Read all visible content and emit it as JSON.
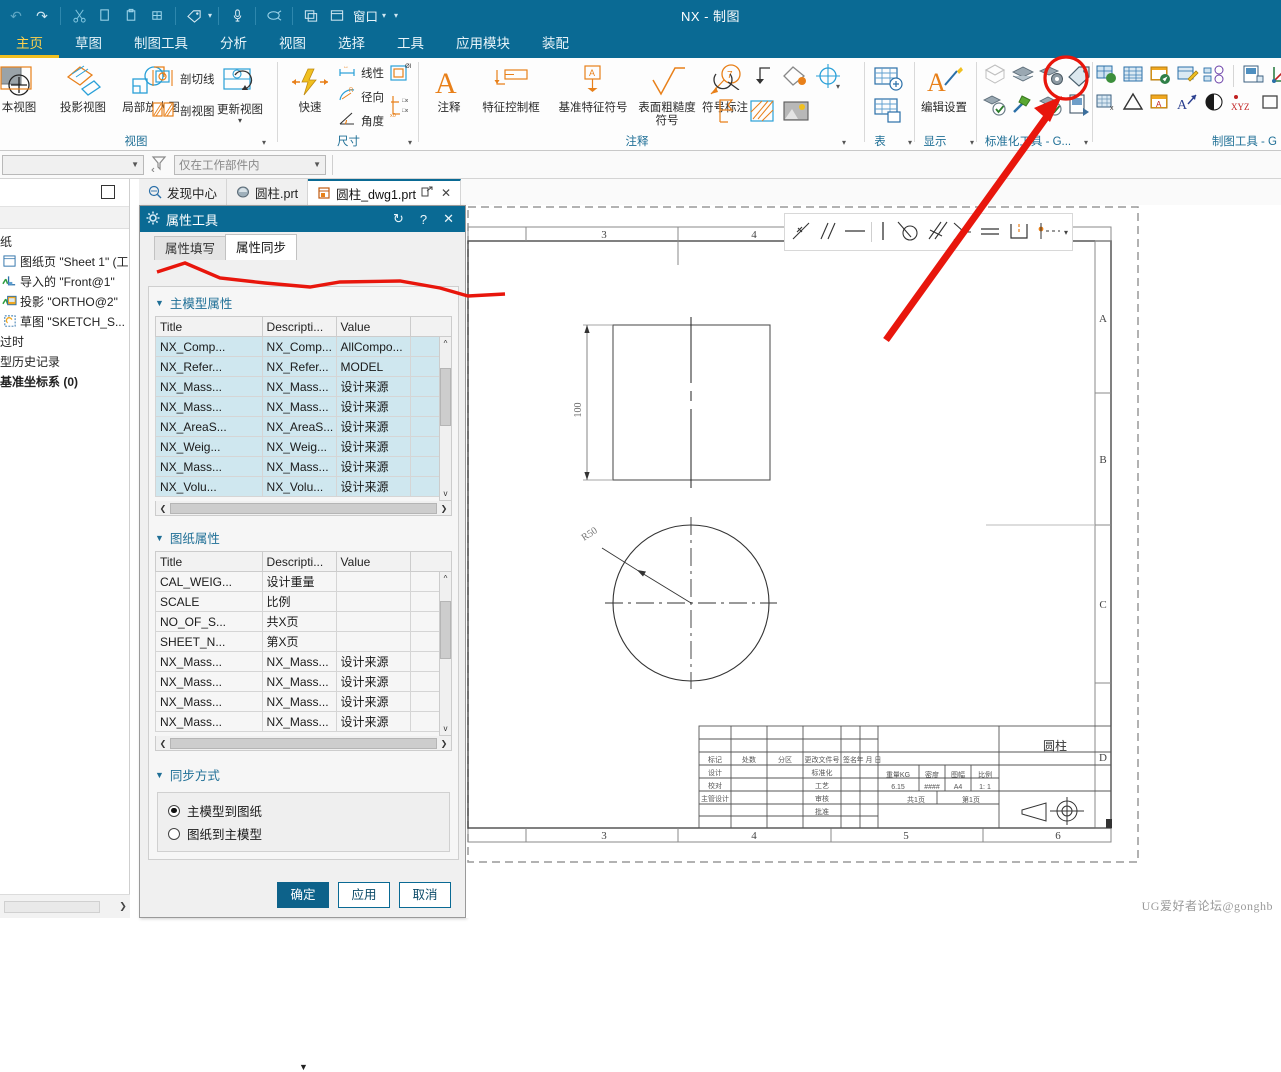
{
  "titlebar": {
    "app_title": "NX - 制图",
    "quick_access": [
      {
        "name": "undo-icon",
        "glyph": "↶"
      },
      {
        "name": "redo-icon",
        "glyph": "↷"
      },
      {
        "name": "cut-icon",
        "glyph": "✂"
      },
      {
        "name": "copy-icon",
        "glyph": "❐"
      },
      {
        "name": "paste-icon",
        "glyph": "📋"
      },
      {
        "name": "paste-special-icon",
        "glyph": "⎘"
      },
      {
        "name": "tag-icon",
        "glyph": "🏷"
      },
      {
        "name": "microphone-icon",
        "glyph": "🎙"
      },
      {
        "name": "command-finder-icon",
        "glyph": "🔊"
      },
      {
        "name": "cascade-windows-icon",
        "glyph": "❏"
      },
      {
        "name": "window-icon",
        "glyph": "▭"
      }
    ],
    "window_label": "窗口"
  },
  "menu": {
    "items": [
      {
        "label": "主页",
        "active": true
      },
      {
        "label": "草图",
        "active": false
      },
      {
        "label": "制图工具",
        "active": false
      },
      {
        "label": "分析",
        "active": false
      },
      {
        "label": "视图",
        "active": false
      },
      {
        "label": "选择",
        "active": false
      },
      {
        "label": "工具",
        "active": false
      },
      {
        "label": "应用模块",
        "active": false
      },
      {
        "label": "装配",
        "active": false
      }
    ]
  },
  "ribbon": {
    "groups": [
      {
        "name": "视图",
        "title": "视图",
        "big_buttons": [
          {
            "label": "本视图",
            "icon": "base-view-icon"
          },
          {
            "label": "投影视图",
            "icon": "projected-view-icon"
          },
          {
            "label": "局部放大图",
            "icon": "detail-view-icon"
          }
        ],
        "small_buttons": [
          {
            "label": "剖切线",
            "icon": "section-line-icon"
          },
          {
            "label": "剖视图",
            "icon": "section-view-icon"
          },
          {
            "label": "更新视图",
            "icon": "update-view-icon"
          }
        ]
      },
      {
        "name": "尺寸",
        "title": "尺寸",
        "big_buttons": [
          {
            "label": "快速",
            "icon": "quick-dimension-icon"
          }
        ],
        "small_buttons": [
          {
            "label": "线性",
            "icon": "linear-dimension-icon"
          },
          {
            "label": "径向",
            "icon": "radial-dimension-icon"
          },
          {
            "label": "角度",
            "icon": "angular-dimension-icon"
          },
          {
            "label": "",
            "icon": "diameter-dimension-icon"
          },
          {
            "label": "",
            "icon": "ordinate-dimension-icon"
          }
        ]
      },
      {
        "name": "注释",
        "title": "注释",
        "big_buttons": [
          {
            "label": "注释",
            "icon": "annotation-icon"
          },
          {
            "label": "特征控制框",
            "icon": "feature-control-frame-icon"
          },
          {
            "label": "基准特征符号",
            "icon": "datum-feature-symbol-icon"
          },
          {
            "label": "表面粗糙度符号",
            "icon": "surface-finish-icon"
          },
          {
            "label": "符号标注",
            "icon": "balloon-icon"
          }
        ],
        "small_buttons": [
          {
            "label": "",
            "icon": "centerline-icon"
          },
          {
            "label": "",
            "icon": "leader-icon"
          },
          {
            "label": "",
            "icon": "weld-symbol-icon"
          },
          {
            "label": "",
            "icon": "target-point-icon"
          },
          {
            "label": "",
            "icon": "flag-note-icon"
          },
          {
            "label": "",
            "icon": "hatch-icon"
          },
          {
            "label": "",
            "icon": "image-icon"
          }
        ]
      },
      {
        "name": "表",
        "title": "表",
        "small_buttons": [
          {
            "label": "",
            "icon": "table-add-icon"
          },
          {
            "label": "",
            "icon": "parts-list-icon"
          }
        ]
      },
      {
        "name": "显示",
        "title": "显示",
        "big_buttons": [
          {
            "label": "编辑设置",
            "icon": "edit-settings-icon"
          }
        ]
      },
      {
        "name": "标准化工具",
        "title": "标准化工具 - G...",
        "small_buttons": [
          {
            "label": "",
            "icon": "check-drawing-icon"
          },
          {
            "label": "",
            "icon": "layers-icon"
          },
          {
            "label": "",
            "icon": "layer-settings-icon"
          },
          {
            "label": "",
            "icon": "attribute-tool-icon"
          },
          {
            "label": "",
            "icon": "validate-icon"
          },
          {
            "label": "",
            "icon": "hammer-icon"
          },
          {
            "label": "",
            "icon": "check-box-icon"
          },
          {
            "label": "",
            "icon": "export-sheet-icon"
          }
        ]
      },
      {
        "name": "制图工具",
        "title": "制图工具 - G",
        "small_buttons": [
          {
            "label": "",
            "icon": "insert-table-icon"
          },
          {
            "label": "",
            "icon": "part-family-icon"
          },
          {
            "label": "",
            "icon": "sheet-navigate-icon"
          },
          {
            "label": "",
            "icon": "edit-sheet-icon"
          },
          {
            "label": "",
            "icon": "numbering-icon"
          },
          {
            "label": "",
            "icon": "batch-plot-icon"
          },
          {
            "label": "",
            "icon": "csys-icon"
          },
          {
            "label": "",
            "icon": "frame-icon"
          },
          {
            "label": "",
            "icon": "grid-x-icon"
          },
          {
            "label": "",
            "icon": "triangle-icon"
          },
          {
            "label": "",
            "icon": "table-a-icon"
          },
          {
            "label": "",
            "icon": "text-arrow-icon"
          },
          {
            "label": "",
            "icon": "sphere-icon"
          },
          {
            "label": "",
            "icon": "xyz-icon"
          },
          {
            "label": "",
            "icon": "square-icon"
          },
          {
            "label": "",
            "icon": "link-table-icon"
          },
          {
            "label": "",
            "icon": "list-icon"
          }
        ]
      }
    ],
    "drawing_tools_label": "制图工具 - G"
  },
  "selection_bar": {
    "type_filter_value": "",
    "filter_icon": "filter-icon",
    "scope_value": "仅在工作部件内"
  },
  "left_panel": {
    "tree": [
      {
        "label": "纸",
        "icon": "drawing-icon",
        "indent": 0
      },
      {
        "label": "图纸页 \"Sheet 1\" (工...",
        "icon": "sheet-icon",
        "indent": 0
      },
      {
        "label": "导入的 \"Front@1\"",
        "icon": "imported-view-icon",
        "indent": 1
      },
      {
        "label": "投影 \"ORTHO@2\"",
        "icon": "projected-view-icon",
        "indent": 1
      },
      {
        "label": "草图 \"SKETCH_S...",
        "icon": "sketch-icon",
        "indent": 1
      },
      {
        "label": "过时",
        "icon": "outdated-icon",
        "indent": 0
      },
      {
        "label": "型历史记录",
        "icon": "history-icon",
        "indent": 0
      },
      {
        "label": "基准坐标系 (0)",
        "icon": "datum-csys-icon",
        "indent": 0
      }
    ]
  },
  "file_tabs": [
    {
      "label": "发现中心",
      "icon": "discovery-center-icon",
      "active": false,
      "closable": false
    },
    {
      "label": "圆柱.prt",
      "icon": "part-icon",
      "active": false,
      "closable": false
    },
    {
      "label": "圆柱_dwg1.prt",
      "icon": "drafting-icon",
      "active": true,
      "closable": true,
      "extra_icon": "detach-icon"
    }
  ],
  "dialog": {
    "title": "属性工具",
    "title_icons": [
      {
        "name": "gear-icon",
        "glyph": "⚙"
      },
      {
        "name": "reset-icon",
        "glyph": "↻"
      },
      {
        "name": "help-icon",
        "glyph": "?"
      },
      {
        "name": "close-icon",
        "glyph": "✕"
      }
    ],
    "tabs": [
      {
        "label": "属性填写",
        "selected": false
      },
      {
        "label": "属性同步",
        "selected": true
      }
    ],
    "section_master": {
      "title": "主模型属性",
      "columns": [
        "Title",
        "Descripti...",
        "Value",
        ""
      ],
      "rows": [
        [
          "NX_Comp...",
          "NX_Comp...",
          "AllCompo...",
          ""
        ],
        [
          "NX_Refer...",
          "NX_Refer...",
          "MODEL",
          ""
        ],
        [
          "NX_Mass...",
          "NX_Mass...",
          "设计来源",
          ""
        ],
        [
          "NX_Mass...",
          "NX_Mass...",
          "设计来源",
          ""
        ],
        [
          "NX_AreaS...",
          "NX_AreaS...",
          "设计来源",
          ""
        ],
        [
          "NX_Weig...",
          "NX_Weig...",
          "设计来源",
          ""
        ],
        [
          "NX_Mass...",
          "NX_Mass...",
          "设计来源",
          ""
        ],
        [
          "NX_Volu...",
          "NX_Volu...",
          "设计来源",
          ""
        ]
      ]
    },
    "section_sheet": {
      "title": "图纸属性",
      "columns": [
        "Title",
        "Descripti...",
        "Value",
        ""
      ],
      "rows": [
        [
          "CAL_WEIG...",
          "设计重量",
          "",
          ""
        ],
        [
          "SCALE",
          "比例",
          "",
          ""
        ],
        [
          "NO_OF_S...",
          "共X页",
          "",
          ""
        ],
        [
          "SHEET_N...",
          "第X页",
          "",
          ""
        ],
        [
          "NX_Mass...",
          "NX_Mass...",
          "设计来源",
          ""
        ],
        [
          "NX_Mass...",
          "NX_Mass...",
          "设计来源",
          ""
        ],
        [
          "NX_Mass...",
          "NX_Mass...",
          "设计来源",
          ""
        ],
        [
          "NX_Mass...",
          "NX_Mass...",
          "设计来源",
          ""
        ]
      ]
    },
    "section_sync": {
      "title": "同步方式",
      "options": [
        {
          "label": "主模型到图纸",
          "selected": true
        },
        {
          "label": "图纸到主模型",
          "selected": false
        }
      ]
    },
    "footer": {
      "ok": "确定",
      "apply": "应用",
      "cancel": "取消"
    }
  },
  "canvas": {
    "float_toolbar_icons": [
      "coincident-constraint-icon",
      "parallel-constraint-icon",
      "horizontal-constraint-icon",
      "vertical-constraint-icon",
      "tangent-constraint-icon",
      "perpendicular-constraint-icon",
      "angle-constraint-icon",
      "equal-constraint-icon",
      "midpoint-constraint-icon",
      "point-on-curve-icon"
    ],
    "sheet": {
      "column_labels_top": [
        "3",
        "4"
      ],
      "column_labels_bottom": [
        "3",
        "4",
        "5",
        "6"
      ],
      "row_labels": [
        "A",
        "B",
        "C",
        "D"
      ]
    },
    "front_view": {
      "dimension": "100"
    },
    "top_view": {
      "dimension": "R50"
    },
    "title_block": {
      "part_name": "圆柱",
      "header_row": [
        "标记",
        "处数",
        "分区",
        "更改文件号",
        "签名",
        "年 月 日"
      ],
      "left_rows": [
        "设计",
        "校对",
        "主管设计",
        ""
      ],
      "mid_rows": [
        "标准化",
        "工艺",
        "审核",
        "批准"
      ],
      "spec_headers": [
        "重量KG",
        "密度",
        "图幅",
        "比例"
      ],
      "spec_values": [
        "6.15",
        "####",
        "A4",
        "1: 1"
      ],
      "page_total": "共1页",
      "page_current": "第1页"
    },
    "watermark": "UG爱好者论坛@gonghb"
  },
  "colors": {
    "title_bar": "#0a6a94",
    "accent_tab": "#ffd24d",
    "section_header_text": "#1f6f96",
    "annotation_red": "#e8160c",
    "ribbon_orange": "#e8801a",
    "ribbon_blue": "#29a0d8"
  }
}
